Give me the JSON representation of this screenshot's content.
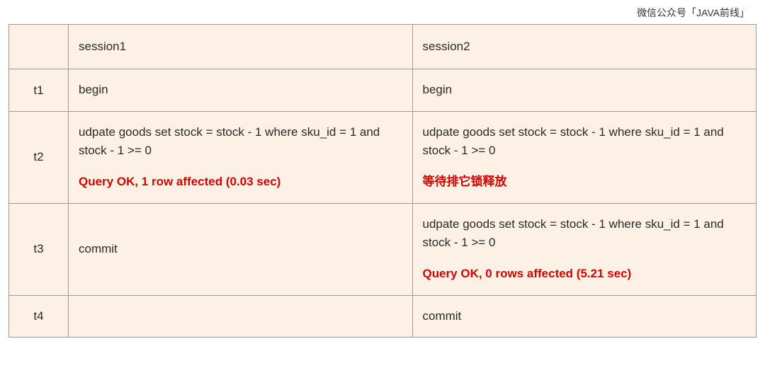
{
  "watermark": "微信公众号「JAVA前线」",
  "headers": {
    "time": "",
    "session1": "session1",
    "session2": "session2"
  },
  "rows": [
    {
      "time": "t1",
      "session1": {
        "text": "begin"
      },
      "session2": {
        "text": "begin"
      }
    },
    {
      "time": "t2",
      "session1": {
        "sql": "udpate goods set stock = stock - 1 where sku_id = 1 and stock - 1 >= 0",
        "result": "Query OK, 1 row affected (0.03 sec)"
      },
      "session2": {
        "sql": "udpate goods set stock = stock - 1 where sku_id = 1 and stock - 1 >= 0",
        "wait": "等待排它锁释放"
      }
    },
    {
      "time": "t3",
      "session1": {
        "text": "commit"
      },
      "session2": {
        "sql": "udpate goods set stock = stock - 1 where sku_id = 1 and stock - 1 >= 0",
        "result": "Query OK, 0 rows affected (5.21 sec)"
      }
    },
    {
      "time": "t4",
      "session1": {
        "text": ""
      },
      "session2": {
        "text": "commit"
      }
    }
  ]
}
